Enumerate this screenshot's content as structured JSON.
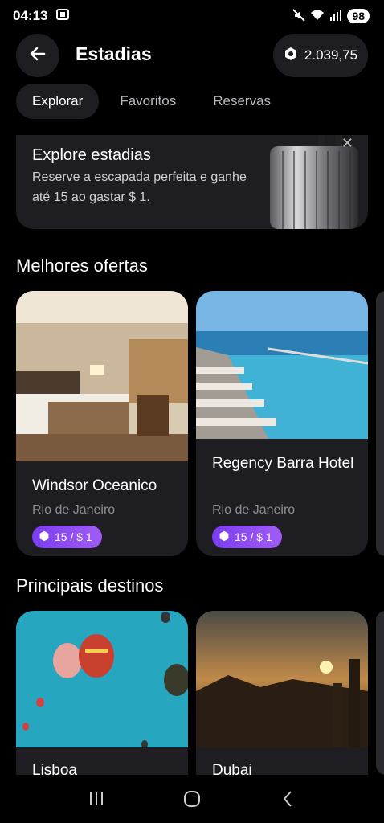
{
  "status": {
    "time": "04:13",
    "battery": "98"
  },
  "header": {
    "title": "Estadias",
    "balance": "2.039,75"
  },
  "tabs": [
    {
      "label": "Explorar",
      "active": true
    },
    {
      "label": "Favoritos",
      "active": false
    },
    {
      "label": "Reservas",
      "active": false
    }
  ],
  "promo": {
    "title": "Explore estadias",
    "text": "Reserve a escapada perfeita e ganhe até 15 ao gastar $ 1."
  },
  "best_offers": {
    "title": "Melhores ofertas",
    "cards": [
      {
        "name": "Windsor Oceanico",
        "location": "Rio de Janeiro",
        "reward": "15 / $ 1"
      },
      {
        "name": "Regency Barra Hotel",
        "location": "Rio de Janeiro",
        "reward": "15 / $ 1"
      }
    ]
  },
  "destinations": {
    "title": "Principais destinos",
    "cards": [
      {
        "name": "Lisboa"
      },
      {
        "name": "Dubai"
      }
    ]
  },
  "colors": {
    "background": "#000000",
    "surface": "#1e1e22",
    "accent": "#8b47f2"
  }
}
